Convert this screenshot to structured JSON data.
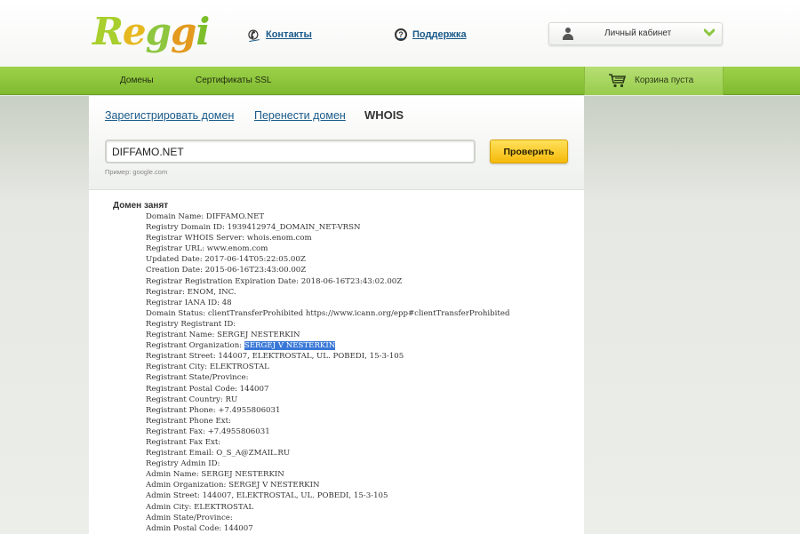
{
  "header": {
    "logo_text": "Reggi",
    "contacts_label": "Контакты",
    "support_label": "Поддержка",
    "cabinet_label": "Личный кабинет"
  },
  "nav": {
    "items": [
      {
        "label": "Домены"
      },
      {
        "label": "Сертификаты SSL"
      }
    ],
    "cart_label": "Корзина пуста"
  },
  "tabs": {
    "register": "Зарегистрировать домен",
    "transfer": "Перенести домен",
    "whois": "WHOIS"
  },
  "search": {
    "value": "DIFFAMO.NET",
    "button_label": "Проверить",
    "example": "Пример: google.com"
  },
  "result": {
    "title": "Домен занят",
    "lines": [
      "Domain Name: DIFFAMO.NET",
      "Registry Domain ID: 1939412974_DOMAIN_NET-VRSN",
      "Registrar WHOIS Server: whois.enom.com",
      "Registrar URL: www.enom.com",
      "Updated Date: 2017-06-14T05:22:05.00Z",
      "Creation Date: 2015-06-16T23:43:00.00Z",
      "Registrar Registration Expiration Date: 2018-06-16T23:43:02.00Z",
      "Registrar: ENOM, INC.",
      "Registrar IANA ID: 48",
      "Domain Status: clientTransferProhibited https://www.icann.org/epp#clientTransferProhibited",
      "Registry Registrant ID:",
      "Registrant Name: SERGEJ NESTERKIN",
      "Registrant Organization: ",
      "Registrant Street: 144007, ELEKTROSTAL, UL. POBEDI, 15-3-105",
      "Registrant City: ELEKTROSTAL",
      "Registrant State/Province:",
      "Registrant Postal Code: 144007",
      "Registrant Country: RU",
      "Registrant Phone: +7.4955806031",
      "Registrant Phone Ext:",
      "Registrant Fax: +7.4955806031",
      "Registrant Fax Ext:",
      "Registrant Email: O_S_A@ZMAIL.RU",
      "Registry Admin ID:",
      "Admin Name: SERGEJ NESTERKIN",
      "Admin Organization: SERGEJ V NESTERKIN",
      "Admin Street: 144007, ELEKTROSTAL, UL. POBEDI, 15-3-105",
      "Admin City: ELEKTROSTAL",
      "Admin State/Province:",
      "Admin Postal Code: 144007"
    ],
    "highlighted_org": "SERGEJ V NESTERKIN"
  },
  "colors": {
    "nav_green": "#8cc63f",
    "link_blue": "#1a5a8a",
    "button_yellow": "#fcd232",
    "selection_blue": "#3a78d8"
  }
}
